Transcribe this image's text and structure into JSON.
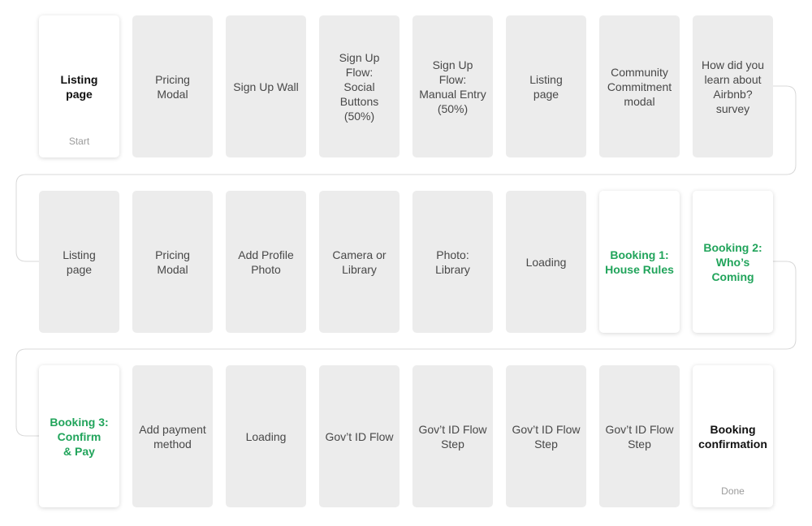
{
  "flow": {
    "rows": [
      [
        {
          "label": "Listing\npage",
          "style": "bold",
          "sub": "Start"
        },
        {
          "label": "Pricing\nModal",
          "style": "gray"
        },
        {
          "label": "Sign Up Wall",
          "style": "gray"
        },
        {
          "label": "Sign Up Flow:\nSocial Buttons\n(50%)",
          "style": "gray"
        },
        {
          "label": "Sign Up Flow:\nManual Entry\n(50%)",
          "style": "gray"
        },
        {
          "label": "Listing\npage",
          "style": "gray"
        },
        {
          "label": "Community\nCommitment\nmodal",
          "style": "gray"
        },
        {
          "label": "How did you\nlearn about\nAirbnb? survey",
          "style": "gray"
        }
      ],
      [
        {
          "label": "Listing\npage",
          "style": "gray"
        },
        {
          "label": "Pricing\nModal",
          "style": "gray"
        },
        {
          "label": "Add Profile\nPhoto",
          "style": "gray"
        },
        {
          "label": "Camera or\nLibrary",
          "style": "gray"
        },
        {
          "label": "Photo: Library",
          "style": "gray"
        },
        {
          "label": "Loading",
          "style": "gray"
        },
        {
          "label": "Booking 1:\nHouse Rules",
          "style": "green"
        },
        {
          "label": "Booking 2:\nWho’s Coming",
          "style": "green"
        }
      ],
      [
        {
          "label": "Booking 3:\nConfirm\n& Pay",
          "style": "green"
        },
        {
          "label": "Add payment\nmethod",
          "style": "gray"
        },
        {
          "label": "Loading",
          "style": "gray"
        },
        {
          "label": "Gov’t ID Flow",
          "style": "gray"
        },
        {
          "label": "Gov’t ID Flow\nStep",
          "style": "gray"
        },
        {
          "label": "Gov’t ID Flow\nStep",
          "style": "gray"
        },
        {
          "label": "Gov’t ID Flow\nStep",
          "style": "gray"
        },
        {
          "label": "Booking\nconfirmation",
          "style": "bold",
          "sub": "Done"
        }
      ]
    ]
  },
  "colors": {
    "card_gray": "#ececec",
    "card_white": "#ffffff",
    "accent_green": "#21a45b",
    "connector": "#d8d8d8"
  }
}
